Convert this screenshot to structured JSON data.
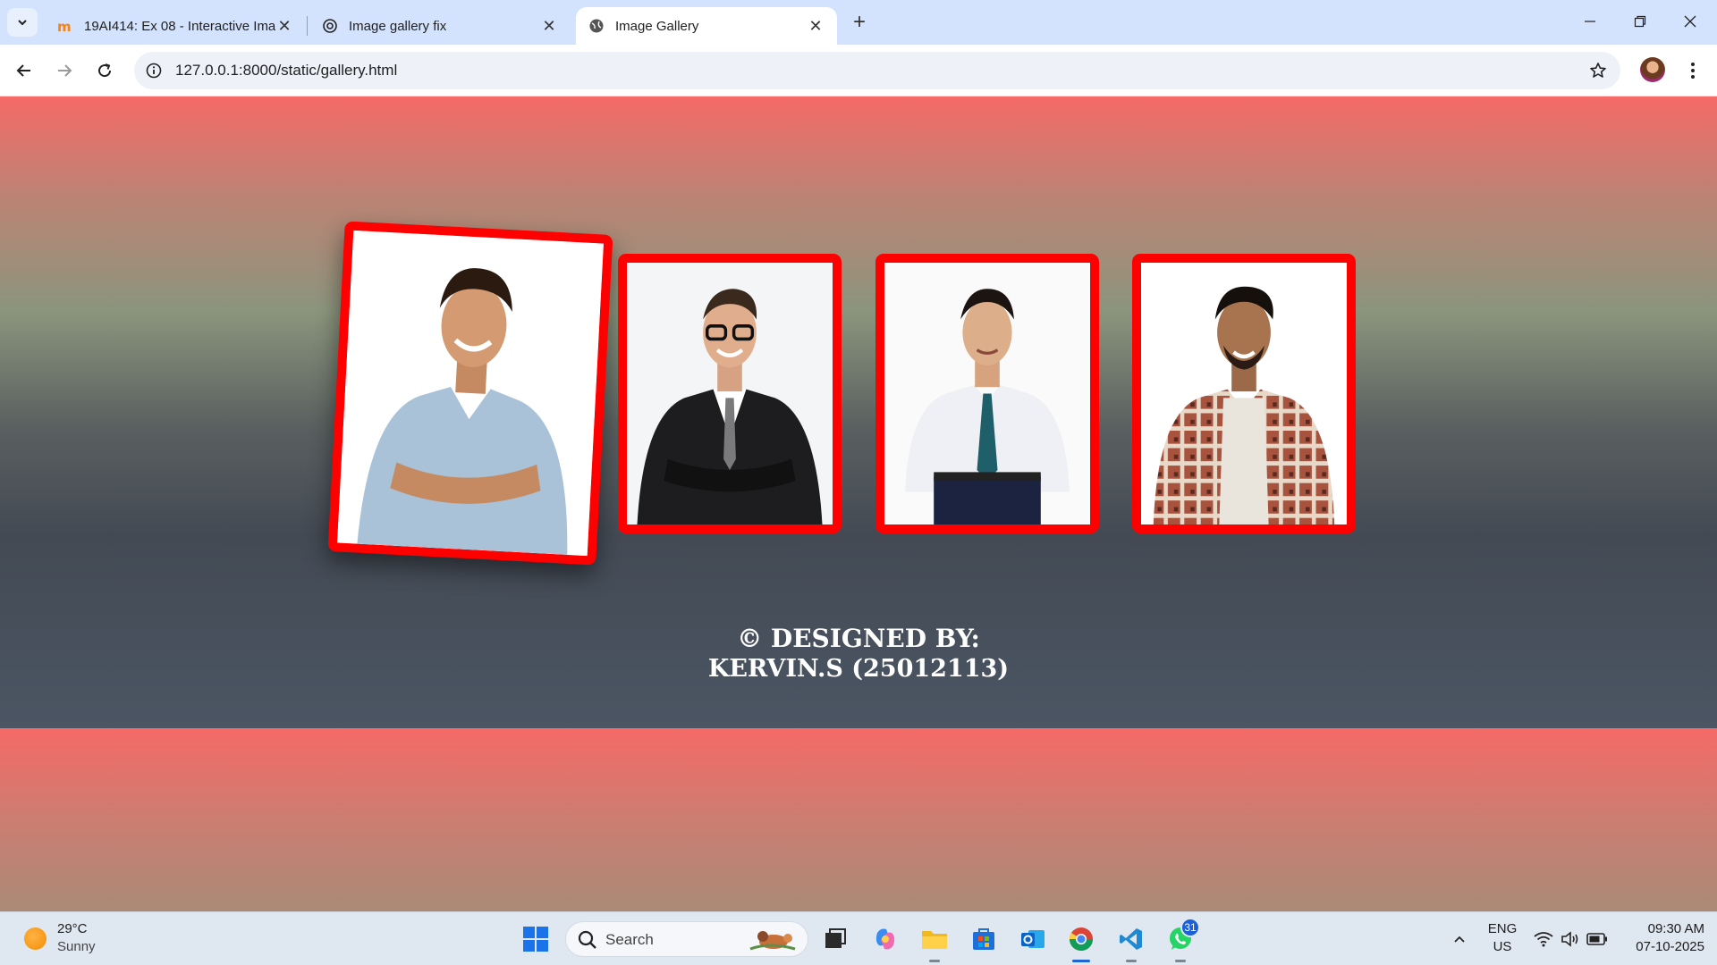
{
  "browser": {
    "tabs": [
      {
        "title": "19AI414: Ex 08 - Interactive Ima",
        "favicon": "moodle-icon",
        "active": false
      },
      {
        "title": "Image gallery fix",
        "favicon": "chatgpt-icon",
        "active": false
      },
      {
        "title": "Image Gallery",
        "favicon": "globe-icon",
        "active": true
      }
    ],
    "new_tab_label": "+",
    "url": "127.0.0.1:8000/static/gallery.html"
  },
  "page": {
    "gallery": [
      {
        "subject": "smiling man in light blue shirt, arms crossed",
        "hovered": true
      },
      {
        "subject": "man in black suit with glasses, arms crossed"
      },
      {
        "subject": "man in white shirt and blue tie"
      },
      {
        "subject": "man in plaid flannel shirt"
      }
    ],
    "footer_line1": "© DESIGNED BY:",
    "footer_line2": "KERVIN.S (25012113)",
    "colors": {
      "frame": "#ff0000",
      "gradient_top": "#f56a67",
      "gradient_bottom": "#4b5563"
    }
  },
  "taskbar": {
    "weather_temp": "29°C",
    "weather_condition": "Sunny",
    "search_label": "Search",
    "whatsapp_badge": "31",
    "language": "ENG",
    "region": "US",
    "time": "09:30 AM",
    "date": "07-10-2025"
  }
}
